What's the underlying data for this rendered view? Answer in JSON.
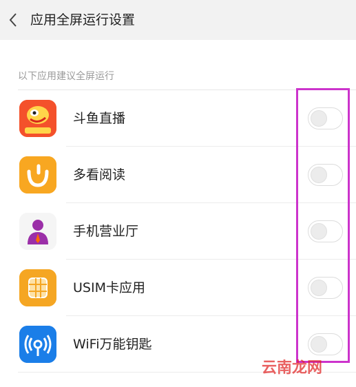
{
  "header": {
    "title": "应用全屏运行设置",
    "back_icon": "chevron-left-icon"
  },
  "section": {
    "label": "以下应用建议全屏运行"
  },
  "apps": [
    {
      "name": "斗鱼直播",
      "icon": "douyu-icon",
      "color": "#f4512b",
      "enabled": false
    },
    {
      "name": "多看阅读",
      "icon": "duokan-icon",
      "color": "#f8a721",
      "enabled": false
    },
    {
      "name": "手机营业厅",
      "icon": "business-hall-icon",
      "color": "#9b2fa8",
      "enabled": false
    },
    {
      "name": "USIM卡应用",
      "icon": "usim-card-icon",
      "color": "#f5a623",
      "enabled": false
    },
    {
      "name": "WiFi万能钥匙",
      "icon": "wifi-key-icon",
      "color": "#1b7ee8",
      "enabled": false
    }
  ],
  "watermark": {
    "text": "云南龙网"
  },
  "colors": {
    "highlight": "#cc33cc",
    "header_bg": "#f2f2f2"
  }
}
